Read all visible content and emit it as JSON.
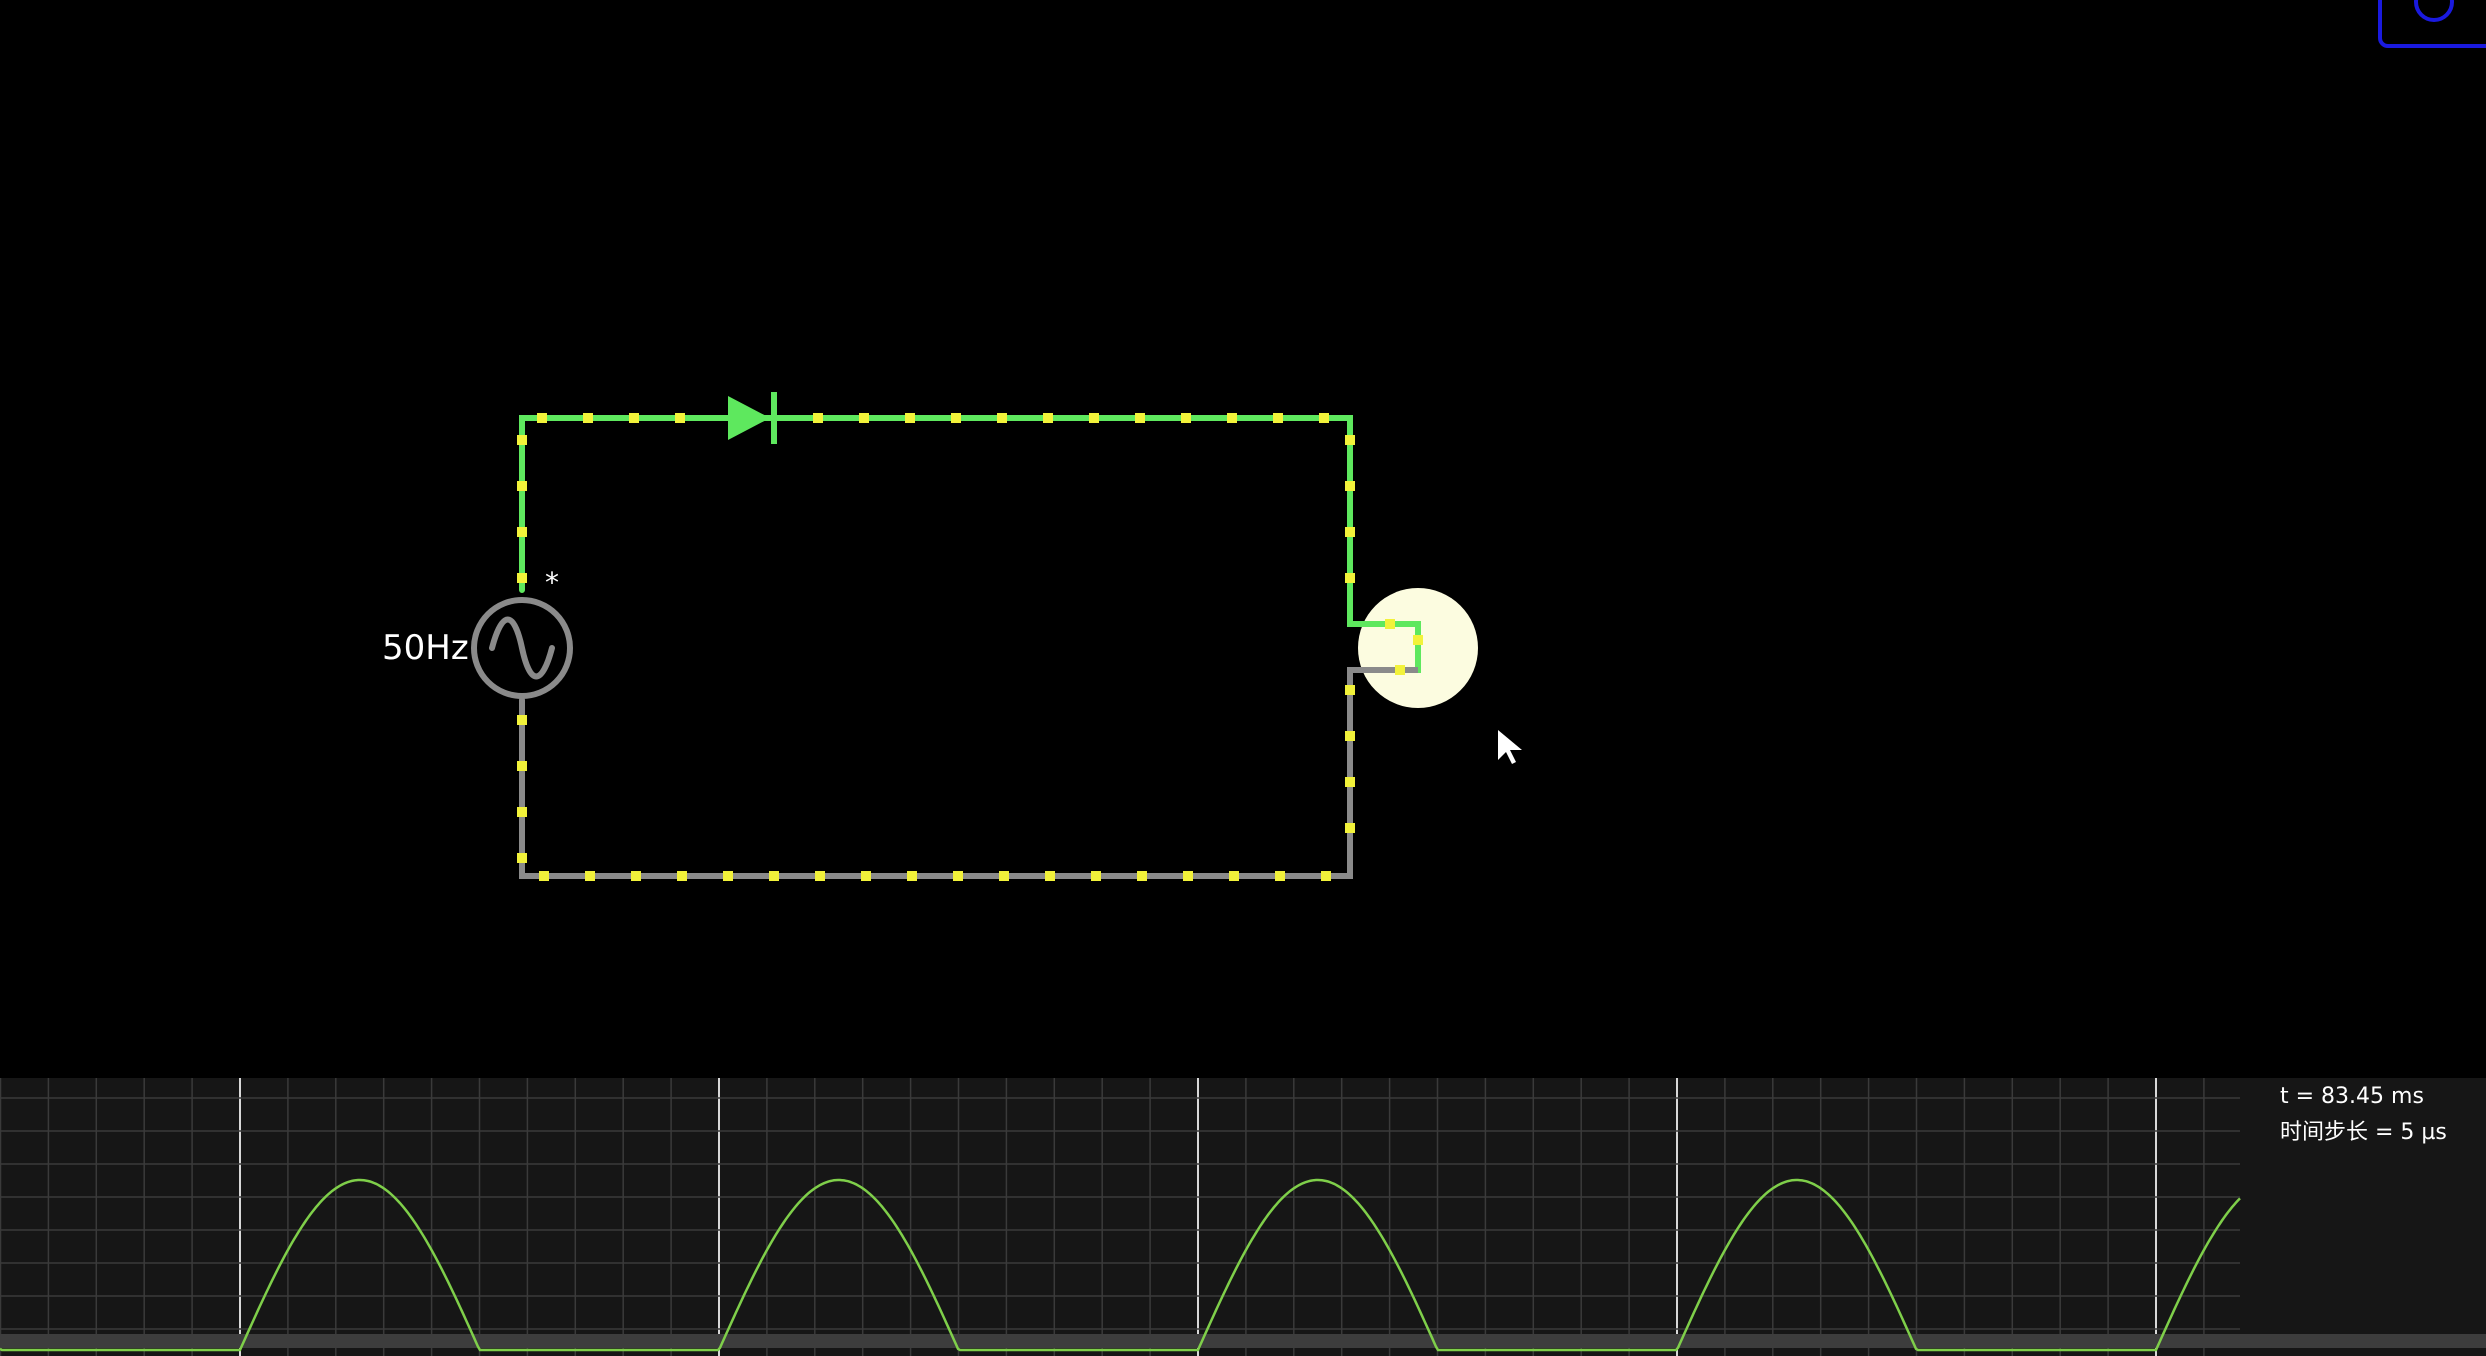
{
  "circuit": {
    "source_frequency_label": "50Hz",
    "source_marker": "*",
    "components": [
      "ac-voltage-source",
      "diode",
      "lamp"
    ],
    "colors": {
      "background": "#000000",
      "wire_active": "#5ee85e",
      "wire_inactive": "#8a8a8a",
      "current_dot": "#f2f23a",
      "lamp_glow": "#fcfce0"
    }
  },
  "scope": {
    "time_label": "t = 83.45 ms",
    "timestep_label": "时间步长 = 5 µs",
    "trace_color": "#7fcf4a",
    "grid_color": "#3a3a3a",
    "major_grid_color": "#d8d8d8",
    "background": "#161616"
  },
  "toolbar": {
    "corner_button_icon": "gear-icon"
  },
  "cursor": {
    "icon": "mouse-pointer-icon"
  }
}
